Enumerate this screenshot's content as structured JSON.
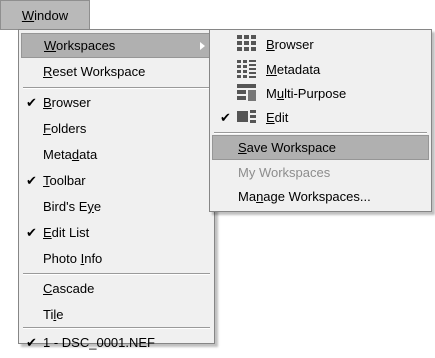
{
  "menubar": {
    "window": "Window"
  },
  "main_menu": {
    "workspaces": "Workspaces",
    "reset_workspace": "Reset Workspace",
    "browser": "Browser",
    "folders": "Folders",
    "metadata": "Metadata",
    "toolbar": "Toolbar",
    "birds_eye": "Bird's Eye",
    "edit_list": "Edit List",
    "photo_info": "Photo Info",
    "cascade": "Cascade",
    "tile": "Tile",
    "open_file": "1 - DSC_0001.NEF"
  },
  "submenu": {
    "browser": "Browser",
    "metadata": "Metadata",
    "multi_purpose": "Multi-Purpose",
    "edit": "Edit",
    "save_workspace": "Save Workspace",
    "my_workspaces": "My Workspaces",
    "manage_workspaces": "Manage Workspaces..."
  },
  "checks": {
    "browser": "✔",
    "toolbar": "✔",
    "edit_list": "✔",
    "open_file": "✔",
    "edit_layout": "✔"
  }
}
